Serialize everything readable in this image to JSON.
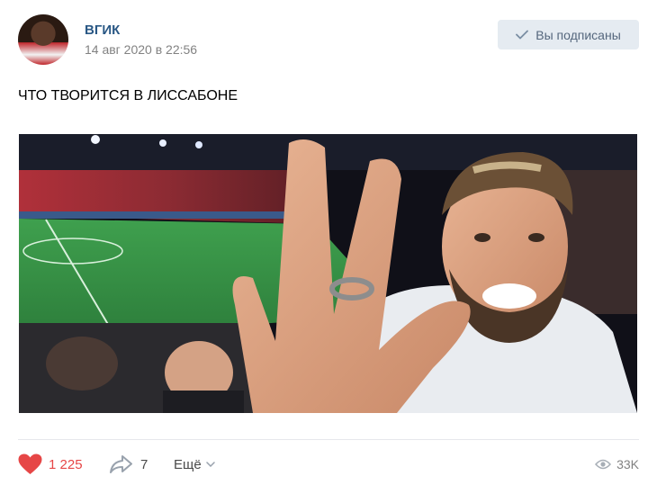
{
  "post": {
    "author": "ВГИК",
    "date": "14 авг 2020 в 22:56",
    "subscribe_label": "Вы подписаны",
    "text": "ЧТО ТВОРИТСЯ В ЛИССАБОНЕ"
  },
  "footer": {
    "likes": "1 225",
    "shares": "7",
    "more_label": "Ещё",
    "views": "33K"
  },
  "colors": {
    "link": "#2a5885",
    "like": "#e64646",
    "button_bg": "#e5ebf1"
  },
  "icons": [
    "checkmark-icon",
    "heart-icon",
    "share-arrow-icon",
    "chevron-down-icon",
    "eye-icon"
  ]
}
